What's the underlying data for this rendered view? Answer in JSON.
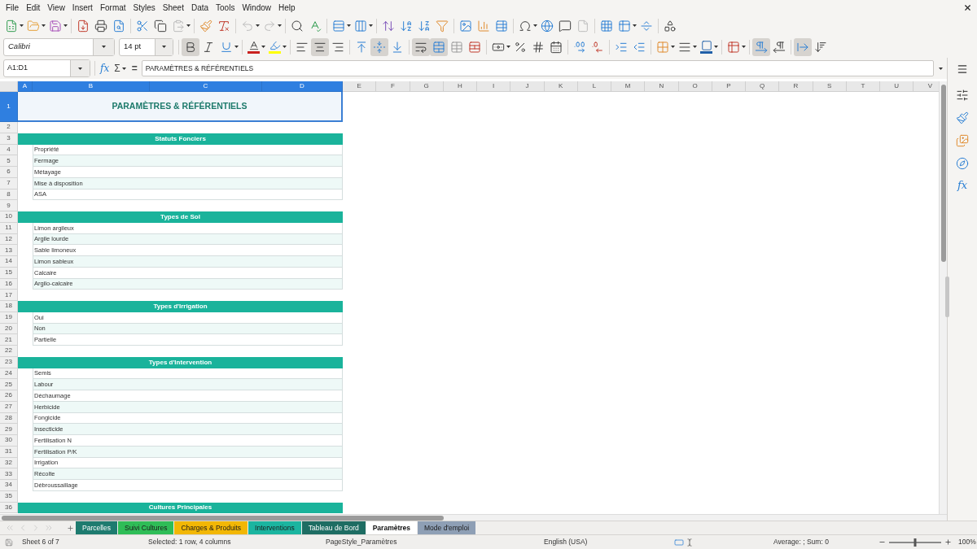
{
  "menu_bar": {
    "items": [
      "File",
      "Edit",
      "View",
      "Insert",
      "Format",
      "Styles",
      "Sheet",
      "Data",
      "Tools",
      "Window",
      "Help"
    ]
  },
  "standard_toolbar": {
    "paste": {
      "disabled": true
    },
    "undo": {
      "disabled": true
    },
    "redo": {
      "disabled": true
    },
    "headers_footers": {
      "disabled": true
    }
  },
  "formatting_toolbar": {
    "font_name": "Calibri",
    "font_size": "14 pt",
    "pressed": {
      "bold": true,
      "italic": false,
      "underline": false,
      "align_left": false,
      "align_center": true,
      "align_right": false,
      "align_top": false,
      "align_middle": true,
      "align_bottom": false,
      "wrap_text": true,
      "merge_and_center": true,
      "left_to_right": true,
      "right_to_left": false,
      "text_horizontal": true,
      "text_vertical": false
    }
  },
  "formula_bar": {
    "name_box": "A1:D1",
    "function_wizard": "fx",
    "sum": "Σ",
    "equals": "=",
    "content": "PARAMÈTRES & RÉFÉRENTIELS"
  },
  "sheet": {
    "columns": [
      {
        "label": "A",
        "selected": true
      },
      {
        "label": "B",
        "selected": true
      },
      {
        "label": "C",
        "selected": true
      },
      {
        "label": "D",
        "selected": true
      },
      {
        "label": "E",
        "selected": false
      },
      {
        "label": "F",
        "selected": false
      },
      {
        "label": "G",
        "selected": false
      },
      {
        "label": "H",
        "selected": false
      },
      {
        "label": "I",
        "selected": false
      },
      {
        "label": "J",
        "selected": false
      },
      {
        "label": "K",
        "selected": false
      },
      {
        "label": "L",
        "selected": false
      },
      {
        "label": "M",
        "selected": false
      },
      {
        "label": "N",
        "selected": false
      },
      {
        "label": "O",
        "selected": false
      },
      {
        "label": "P",
        "selected": false
      },
      {
        "label": "Q",
        "selected": false
      },
      {
        "label": "R",
        "selected": false
      },
      {
        "label": "S",
        "selected": false
      },
      {
        "label": "T",
        "selected": false
      },
      {
        "label": "U",
        "selected": false
      },
      {
        "label": "V",
        "selected": false
      }
    ],
    "rows": [
      {
        "label": "1",
        "selected": true
      },
      {
        "label": "2",
        "selected": false
      },
      {
        "label": "3",
        "selected": false
      },
      {
        "label": "4",
        "selected": false
      },
      {
        "label": "5",
        "selected": false
      },
      {
        "label": "6",
        "selected": false
      },
      {
        "label": "7",
        "selected": false
      },
      {
        "label": "8",
        "selected": false
      },
      {
        "label": "9",
        "selected": false
      },
      {
        "label": "10",
        "selected": false
      },
      {
        "label": "11",
        "selected": false
      },
      {
        "label": "12",
        "selected": false
      },
      {
        "label": "13",
        "selected": false
      },
      {
        "label": "14",
        "selected": false
      },
      {
        "label": "15",
        "selected": false
      },
      {
        "label": "16",
        "selected": false
      },
      {
        "label": "17",
        "selected": false
      },
      {
        "label": "18",
        "selected": false
      },
      {
        "label": "19",
        "selected": false
      },
      {
        "label": "20",
        "selected": false
      },
      {
        "label": "21",
        "selected": false
      },
      {
        "label": "22",
        "selected": false
      },
      {
        "label": "23",
        "selected": false
      },
      {
        "label": "24",
        "selected": false
      },
      {
        "label": "25",
        "selected": false
      },
      {
        "label": "26",
        "selected": false
      },
      {
        "label": "27",
        "selected": false
      },
      {
        "label": "28",
        "selected": false
      },
      {
        "label": "29",
        "selected": false
      },
      {
        "label": "30",
        "selected": false
      },
      {
        "label": "31",
        "selected": false
      },
      {
        "label": "32",
        "selected": false
      },
      {
        "label": "33",
        "selected": false
      },
      {
        "label": "34",
        "selected": false
      },
      {
        "label": "35",
        "selected": false
      },
      {
        "label": "36",
        "selected": false
      }
    ],
    "title": "PARAMÈTRES & RÉFÉRENTIELS",
    "sections": [
      {
        "heading": "Statuts Fonciers",
        "items": [
          "Propriété",
          "Fermage",
          "Métayage",
          "Mise à disposition",
          "ASA"
        ]
      },
      {
        "heading": "Types de Sol",
        "items": [
          "Limon argileux",
          "Argile lourde",
          "Sable limoneux",
          "Limon sableux",
          "Calcaire",
          "Argilo-calcaire"
        ]
      },
      {
        "heading": "Types d'Irrigation",
        "items": [
          "Oui",
          "Non",
          "Partielle"
        ]
      },
      {
        "heading": "Types d'Intervention",
        "items": [
          "Semis",
          "Labour",
          "Déchaumage",
          "Herbicide",
          "Fongicide",
          "Insecticide",
          "Fertilisation N",
          "Fertilisation P/K",
          "Irrigation",
          "Récolte",
          "Débroussaillage"
        ]
      },
      {
        "heading": "Cultures Principales"
      }
    ]
  },
  "sidebar": {
    "functions": "fx"
  },
  "sheet_tabs": [
    {
      "label": "Parcelles",
      "color": "#1e7b6f",
      "selected": false
    },
    {
      "label": "Suivi Cultures",
      "color": "#2fbd57",
      "selected": false
    },
    {
      "label": "Charges & Produits",
      "color": "#f2b705",
      "selected": false
    },
    {
      "label": "Interventions",
      "color": "#1bb5a0",
      "selected": false
    },
    {
      "label": "Tableau de Bord",
      "color": "#1e6d63",
      "selected": false
    },
    {
      "label": "Paramètres",
      "selected": true
    },
    {
      "label": "Mode d'emploi",
      "color": "#8e9fb5",
      "selected": false
    }
  ],
  "status_bar": {
    "sheet": "Sheet 6 of 7",
    "selection": "Selected: 1 row, 4 columns",
    "page_style": "PageStyle_Paramètres",
    "language": "English (USA)",
    "summary": "Average: ; Sum: 0",
    "zoom": {
      "level": 0.5,
      "reading": "100%"
    }
  }
}
